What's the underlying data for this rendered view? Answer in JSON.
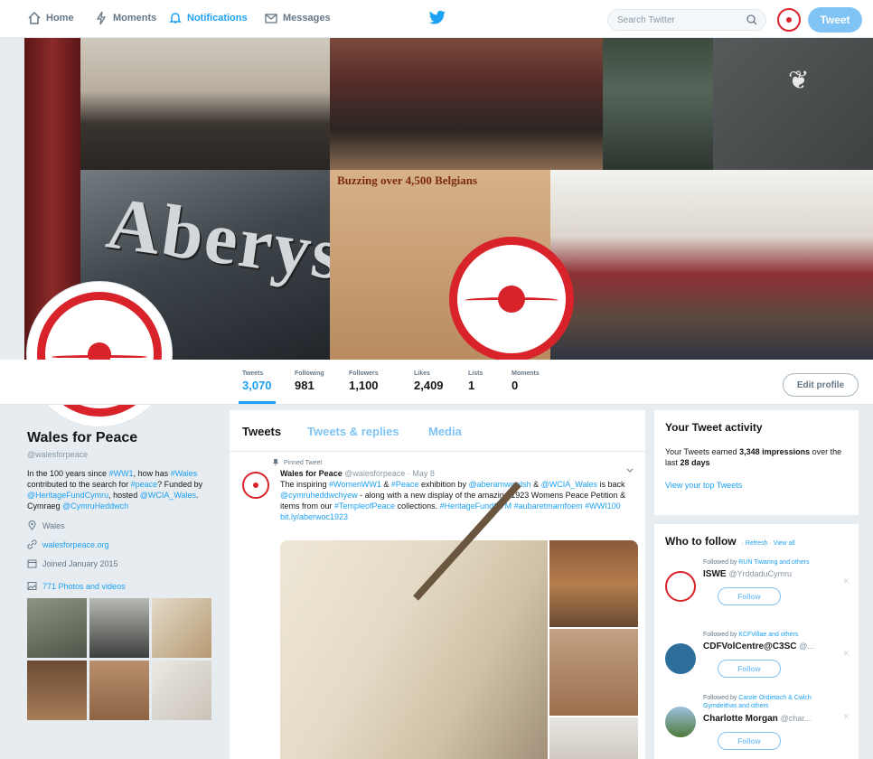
{
  "nav": {
    "home": "Home",
    "moments": "Moments",
    "notifications": "Notifications",
    "messages": "Messages",
    "search_placeholder": "Search Twitter",
    "tweet": "Tweet"
  },
  "banner": {
    "sign_text": "Aberystwyth",
    "newspaper_headline": "Buzzing over 4,500 Belgians"
  },
  "stats": [
    {
      "label": "Tweets",
      "value": "3,070"
    },
    {
      "label": "Following",
      "value": "981"
    },
    {
      "label": "Followers",
      "value": "1,100"
    },
    {
      "label": "Likes",
      "value": "2,409"
    },
    {
      "label": "Lists",
      "value": "1"
    },
    {
      "label": "Moments",
      "value": "0"
    }
  ],
  "edit_profile": "Edit profile",
  "profile": {
    "name": "Wales for Peace",
    "handle": "@walesforpeace",
    "bio_1": "In the 100 years since ",
    "bio_link_1": "#WW1",
    "bio_2": ", how has ",
    "bio_link_2": "#Wales",
    "bio_3": " contributed to the search for ",
    "bio_link_3": "#peace",
    "bio_4": "? Funded by ",
    "bio_link_4": "@HeritageFundCymru",
    "bio_5": ", hosted ",
    "bio_link_5": "@WCIA_Wales",
    "bio_6": ". Cymraeg ",
    "bio_link_6": "@CymruHeddwch",
    "location": "Wales",
    "website": "walesforpeace.org",
    "joined": "Joined January 2015",
    "photos": "771 Photos and videos"
  },
  "timeline": {
    "tabs": [
      "Tweets",
      "Tweets & replies",
      "Media"
    ],
    "pinned": "Pinned Tweet",
    "name": "Wales for Peace",
    "handle": "@walesforpeace · May 8",
    "body_1": "The inspiring ",
    "link_1": "#WomenWW1",
    "body_2": " & ",
    "link_2": "#Peace",
    "body_3": " exhibition by ",
    "link_3": "@aberamwwelsh",
    "body_4": " & ",
    "link_4": "@WCIA_Wales",
    "body_5": " is back ",
    "link_5": "@cymruheddwchyew",
    "body_6": " - along with a new display of the amazing 1923 Womens Peace Petition & items from our ",
    "link_6": "#TempleofPeace",
    "body_7": " collections. ",
    "link_7": "#HeritageFundCYM #aubaretmarnfoem #WWI100 bit.ly/aberwoc1923"
  },
  "activity": {
    "title": "Your Tweet activity",
    "text_1": "Your Tweets earned ",
    "impressions": "3,348 impressions",
    "text_2": " over the last ",
    "days": "28 days",
    "link": "View your top Tweets"
  },
  "who_to_follow": {
    "title": "Who to follow",
    "sub": "· Refresh · View all",
    "follow_label": "Follow",
    "suggestions": [
      {
        "by": "Followed by ",
        "by_link": "RUN Tiwaring and others",
        "name": "ISWE",
        "handle": "@YrddaduCymru"
      },
      {
        "by": "Followed by ",
        "by_link": "KCFVillae and others",
        "name": "CDFVolCentre@C3SC",
        "handle": "@..."
      },
      {
        "by": "Followed by ",
        "by_link": "Carole Ordietach & Cwlch Gymdeithas and others",
        "name": "Charlotte Morgan",
        "handle": "@char..."
      }
    ]
  },
  "colors": {
    "brand_blue": "#1da1f2",
    "peace_red": "#d8232a"
  }
}
